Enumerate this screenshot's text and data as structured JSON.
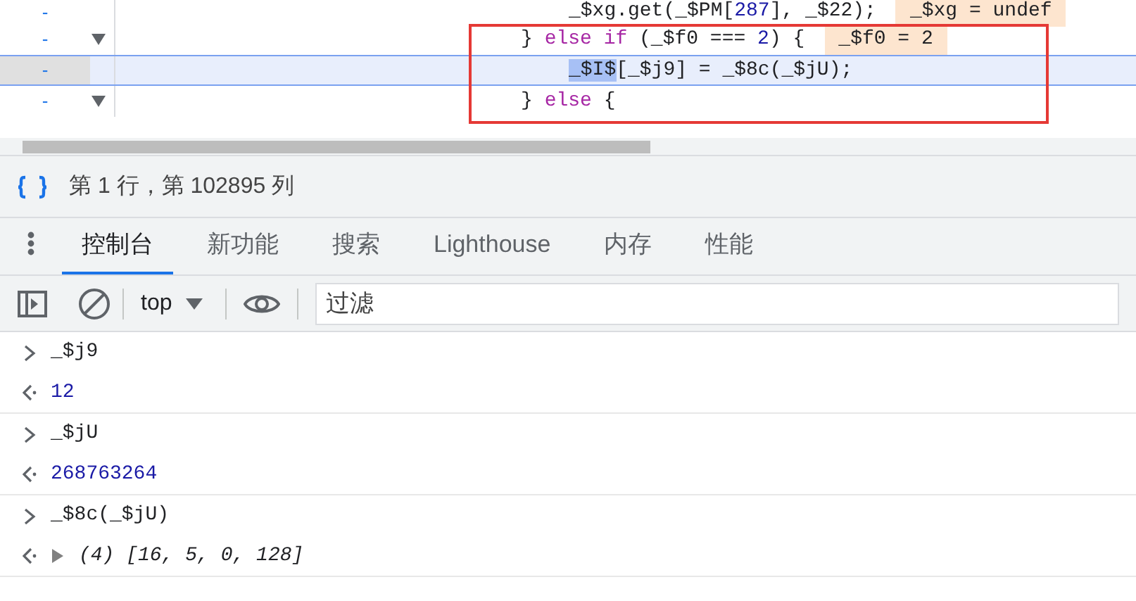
{
  "code_lines": [
    {
      "marker": "-",
      "foldable": false,
      "selected": false,
      "indented": true,
      "tokens": [
        {
          "text": "_$xg.get(_$PM[",
          "kind": "plain"
        },
        {
          "text": "287",
          "kind": "number"
        },
        {
          "text": "], _$22);",
          "kind": "plain"
        }
      ],
      "inline_value": "_$xg = undef"
    },
    {
      "marker": "-",
      "foldable": true,
      "selected": false,
      "indented": false,
      "tokens": [
        {
          "text": "} ",
          "kind": "plain"
        },
        {
          "text": "else if",
          "kind": "keyword"
        },
        {
          "text": " (_$f0 === ",
          "kind": "plain"
        },
        {
          "text": "2",
          "kind": "number"
        },
        {
          "text": ") {",
          "kind": "plain"
        }
      ],
      "inline_value": "_$f0 = 2"
    },
    {
      "marker": "-",
      "foldable": false,
      "selected": true,
      "indented": true,
      "tokens": [
        {
          "text": "_$I$",
          "kind": "highlight"
        },
        {
          "text": "[_$j9] = _$8c(_$jU);",
          "kind": "plain"
        }
      ]
    },
    {
      "marker": "-",
      "foldable": true,
      "selected": false,
      "indented": false,
      "tokens": [
        {
          "text": "} ",
          "kind": "plain"
        },
        {
          "text": "else",
          "kind": "keyword"
        },
        {
          "text": " {",
          "kind": "plain"
        }
      ]
    }
  ],
  "status_bar": {
    "position": "第 1 行，第 102895 列"
  },
  "tabs": [
    {
      "label": "控制台",
      "selected": true
    },
    {
      "label": "新功能",
      "selected": false
    },
    {
      "label": "搜索",
      "selected": false
    },
    {
      "label": "Lighthouse",
      "selected": false
    },
    {
      "label": "内存",
      "selected": false
    },
    {
      "label": "性能",
      "selected": false
    }
  ],
  "toolbar": {
    "context": "top",
    "filter": {
      "placeholder": "过滤"
    }
  },
  "console": [
    {
      "kind": "input",
      "text": "_$j9"
    },
    {
      "kind": "number",
      "text": "12"
    },
    {
      "kind": "input",
      "text": "_$jU"
    },
    {
      "kind": "number",
      "text": "268763264"
    },
    {
      "kind": "input",
      "text": "_$8c(_$jU)"
    },
    {
      "kind": "array",
      "count": "(4)",
      "text": "[16, 5, 0, 128]"
    }
  ]
}
